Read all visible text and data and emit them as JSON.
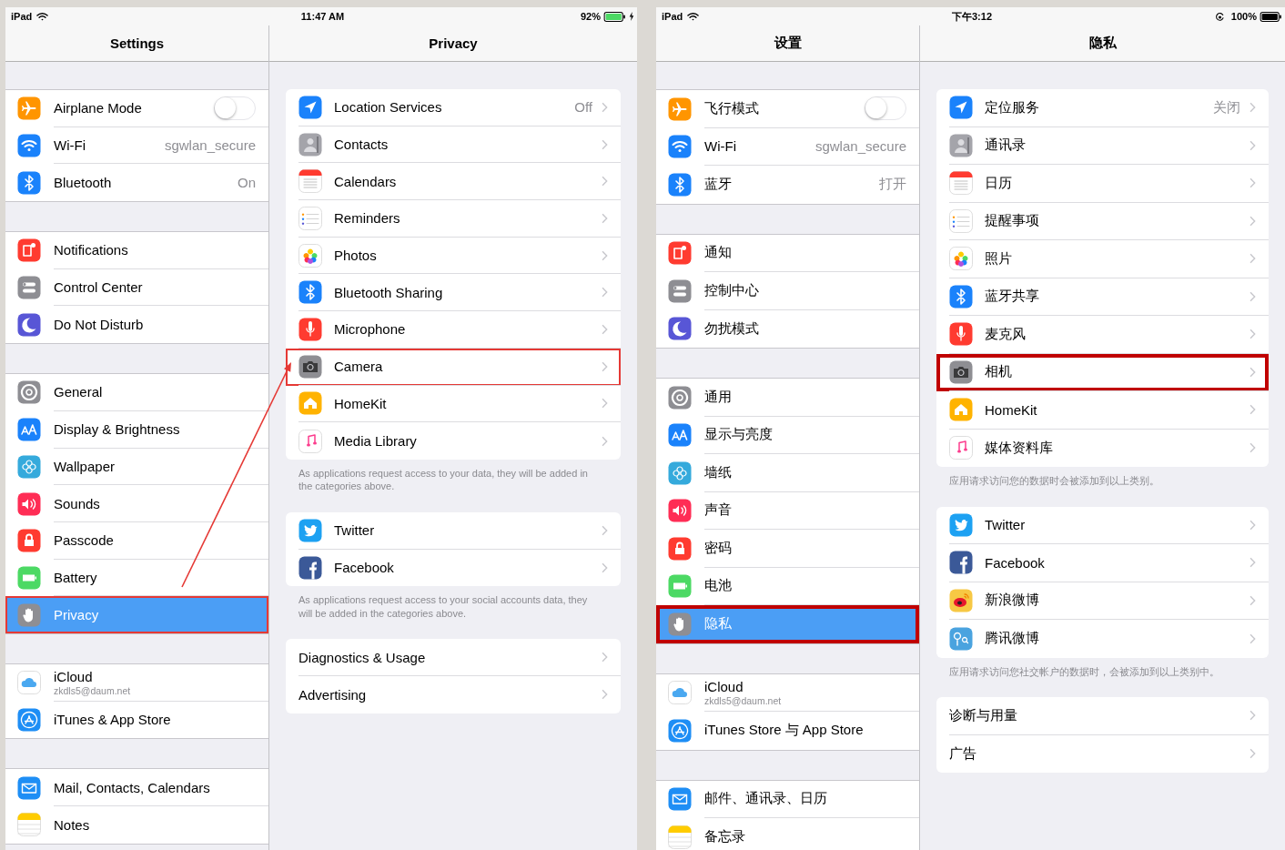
{
  "screens": [
    {
      "status": {
        "carrier": "iPad",
        "time": "11:47 AM",
        "battery": "92%",
        "charging": true,
        "rotation_lock": false
      },
      "arrow": true,
      "master": {
        "title": "Settings",
        "groups": [
          {
            "items": [
              {
                "kind": "airplane",
                "label": "Airplane Mode",
                "on": false,
                "selected": false,
                "highlighted": false
              },
              {
                "kind": "wifi",
                "label": "Wi-Fi",
                "value": "sgwlan_secure",
                "selected": false,
                "highlighted": false
              },
              {
                "kind": "bluetooth",
                "label": "Bluetooth",
                "value": "On",
                "selected": false,
                "highlighted": false
              }
            ]
          },
          {
            "items": [
              {
                "kind": "notifications",
                "label": "Notifications",
                "selected": false,
                "highlighted": false
              },
              {
                "kind": "control",
                "label": "Control Center",
                "selected": false,
                "highlighted": false
              },
              {
                "kind": "moon",
                "label": "Do Not Disturb",
                "selected": false,
                "highlighted": false
              }
            ]
          },
          {
            "items": [
              {
                "kind": "gear",
                "label": "General",
                "selected": false,
                "highlighted": false
              },
              {
                "kind": "display",
                "label": "Display & Brightness",
                "selected": false,
                "highlighted": false
              },
              {
                "kind": "wallpaper",
                "label": "Wallpaper",
                "selected": false,
                "highlighted": false
              },
              {
                "kind": "sounds",
                "label": "Sounds",
                "selected": false,
                "highlighted": false
              },
              {
                "kind": "lock",
                "label": "Passcode",
                "selected": false,
                "highlighted": false
              },
              {
                "kind": "battery",
                "label": "Battery",
                "selected": false,
                "highlighted": false
              },
              {
                "kind": "hand",
                "label": "Privacy",
                "selected": true,
                "highlighted": true
              }
            ]
          },
          {
            "items": [
              {
                "kind": "icloud",
                "label": "iCloud",
                "subtitle": "zkdls5@daum.net",
                "selected": false,
                "highlighted": false
              },
              {
                "kind": "appstore",
                "label": "iTunes & App Store",
                "selected": false,
                "highlighted": false
              }
            ]
          },
          {
            "items": [
              {
                "kind": "mail",
                "label": "Mail, Contacts, Calendars",
                "selected": false,
                "highlighted": false
              },
              {
                "kind": "notes",
                "label": "Notes",
                "selected": false,
                "highlighted": false
              }
            ]
          }
        ]
      },
      "detail": {
        "title": "Privacy",
        "groups": [
          {
            "items": [
              {
                "kind": "location",
                "label": "Location Services",
                "value": "Off",
                "highlighted": false
              },
              {
                "kind": "contacts",
                "label": "Contacts",
                "highlighted": false
              },
              {
                "kind": "calendar",
                "label": "Calendars",
                "highlighted": false
              },
              {
                "kind": "reminders",
                "label": "Reminders",
                "highlighted": false
              },
              {
                "kind": "photos",
                "label": "Photos",
                "highlighted": false
              },
              {
                "kind": "bluetooth",
                "label": "Bluetooth Sharing",
                "highlighted": false
              },
              {
                "kind": "mic",
                "label": "Microphone",
                "highlighted": false
              },
              {
                "kind": "camera",
                "label": "Camera",
                "highlighted": true
              },
              {
                "kind": "homekit",
                "label": "HomeKit",
                "highlighted": false
              },
              {
                "kind": "music",
                "label": "Media Library",
                "highlighted": false
              }
            ],
            "footer": "As applications request access to your data, they will be added in the categories above."
          },
          {
            "items": [
              {
                "kind": "twitter",
                "label": "Twitter",
                "highlighted": false
              },
              {
                "kind": "facebook",
                "label": "Facebook",
                "highlighted": false
              }
            ],
            "footer": "As applications request access to your social accounts data, they will be added in the categories above."
          },
          {
            "items": [
              {
                "kind": "text",
                "label": "Diagnostics & Usage",
                "highlighted": false
              },
              {
                "kind": "text",
                "label": "Advertising",
                "highlighted": false
              }
            ]
          }
        ]
      }
    },
    {
      "status": {
        "carrier": "iPad",
        "time": "下午3:12",
        "battery": "100%",
        "charging": false,
        "rotation_lock": true
      },
      "arrow": false,
      "master": {
        "title": "设置",
        "groups": [
          {
            "items": [
              {
                "kind": "airplane",
                "label": "飞行模式",
                "on": false,
                "selected": false,
                "highlighted": false
              },
              {
                "kind": "wifi",
                "label": "Wi-Fi",
                "value": "sgwlan_secure",
                "selected": false,
                "highlighted": false
              },
              {
                "kind": "bluetooth",
                "label": "蓝牙",
                "value": "打开",
                "selected": false,
                "highlighted": false
              }
            ]
          },
          {
            "items": [
              {
                "kind": "notifications",
                "label": "通知",
                "selected": false,
                "highlighted": false
              },
              {
                "kind": "control",
                "label": "控制中心",
                "selected": false,
                "highlighted": false
              },
              {
                "kind": "moon",
                "label": "勿扰模式",
                "selected": false,
                "highlighted": false
              }
            ]
          },
          {
            "items": [
              {
                "kind": "gear",
                "label": "通用",
                "selected": false,
                "highlighted": false
              },
              {
                "kind": "display",
                "label": "显示与亮度",
                "selected": false,
                "highlighted": false
              },
              {
                "kind": "wallpaper",
                "label": "墙纸",
                "selected": false,
                "highlighted": false
              },
              {
                "kind": "sounds",
                "label": "声音",
                "selected": false,
                "highlighted": false
              },
              {
                "kind": "lock",
                "label": "密码",
                "selected": false,
                "highlighted": false
              },
              {
                "kind": "battery",
                "label": "电池",
                "selected": false,
                "highlighted": false
              },
              {
                "kind": "hand",
                "label": "隐私",
                "selected": true,
                "highlighted": true
              }
            ]
          },
          {
            "items": [
              {
                "kind": "icloud",
                "label": "iCloud",
                "subtitle": "zkdls5@daum.net",
                "selected": false,
                "highlighted": false
              },
              {
                "kind": "appstore",
                "label": "iTunes Store 与 App Store",
                "selected": false,
                "highlighted": false
              }
            ]
          },
          {
            "items": [
              {
                "kind": "mail",
                "label": "邮件、通讯录、日历",
                "selected": false,
                "highlighted": false
              },
              {
                "kind": "notes",
                "label": "备忘录",
                "selected": false,
                "highlighted": false
              }
            ]
          }
        ]
      },
      "detail": {
        "title": "隐私",
        "groups": [
          {
            "items": [
              {
                "kind": "location",
                "label": "定位服务",
                "value": "关闭",
                "highlighted": false
              },
              {
                "kind": "contacts",
                "label": "通讯录",
                "highlighted": false
              },
              {
                "kind": "calendar",
                "label": "日历",
                "highlighted": false
              },
              {
                "kind": "reminders",
                "label": "提醒事项",
                "highlighted": false
              },
              {
                "kind": "photos",
                "label": "照片",
                "highlighted": false
              },
              {
                "kind": "bluetooth",
                "label": "蓝牙共享",
                "highlighted": false
              },
              {
                "kind": "mic",
                "label": "麦克风",
                "highlighted": false
              },
              {
                "kind": "camera",
                "label": "相机",
                "highlighted": true
              },
              {
                "kind": "homekit",
                "label": "HomeKit",
                "highlighted": false
              },
              {
                "kind": "music",
                "label": "媒体资料库",
                "highlighted": false
              }
            ],
            "footer": "应用请求访问您的数据时会被添加到以上类别。"
          },
          {
            "items": [
              {
                "kind": "twitter",
                "label": "Twitter",
                "highlighted": false
              },
              {
                "kind": "facebook",
                "label": "Facebook",
                "highlighted": false
              },
              {
                "kind": "weibo",
                "label": "新浪微博",
                "highlighted": false
              },
              {
                "kind": "tencent",
                "label": "腾讯微博",
                "highlighted": false
              }
            ],
            "footer": "应用请求访问您社交帐户的数据时，会被添加到以上类别中。"
          },
          {
            "items": [
              {
                "kind": "text",
                "label": "诊断与用量",
                "highlighted": false
              },
              {
                "kind": "text",
                "label": "广告",
                "highlighted": false
              }
            ]
          }
        ]
      }
    }
  ]
}
